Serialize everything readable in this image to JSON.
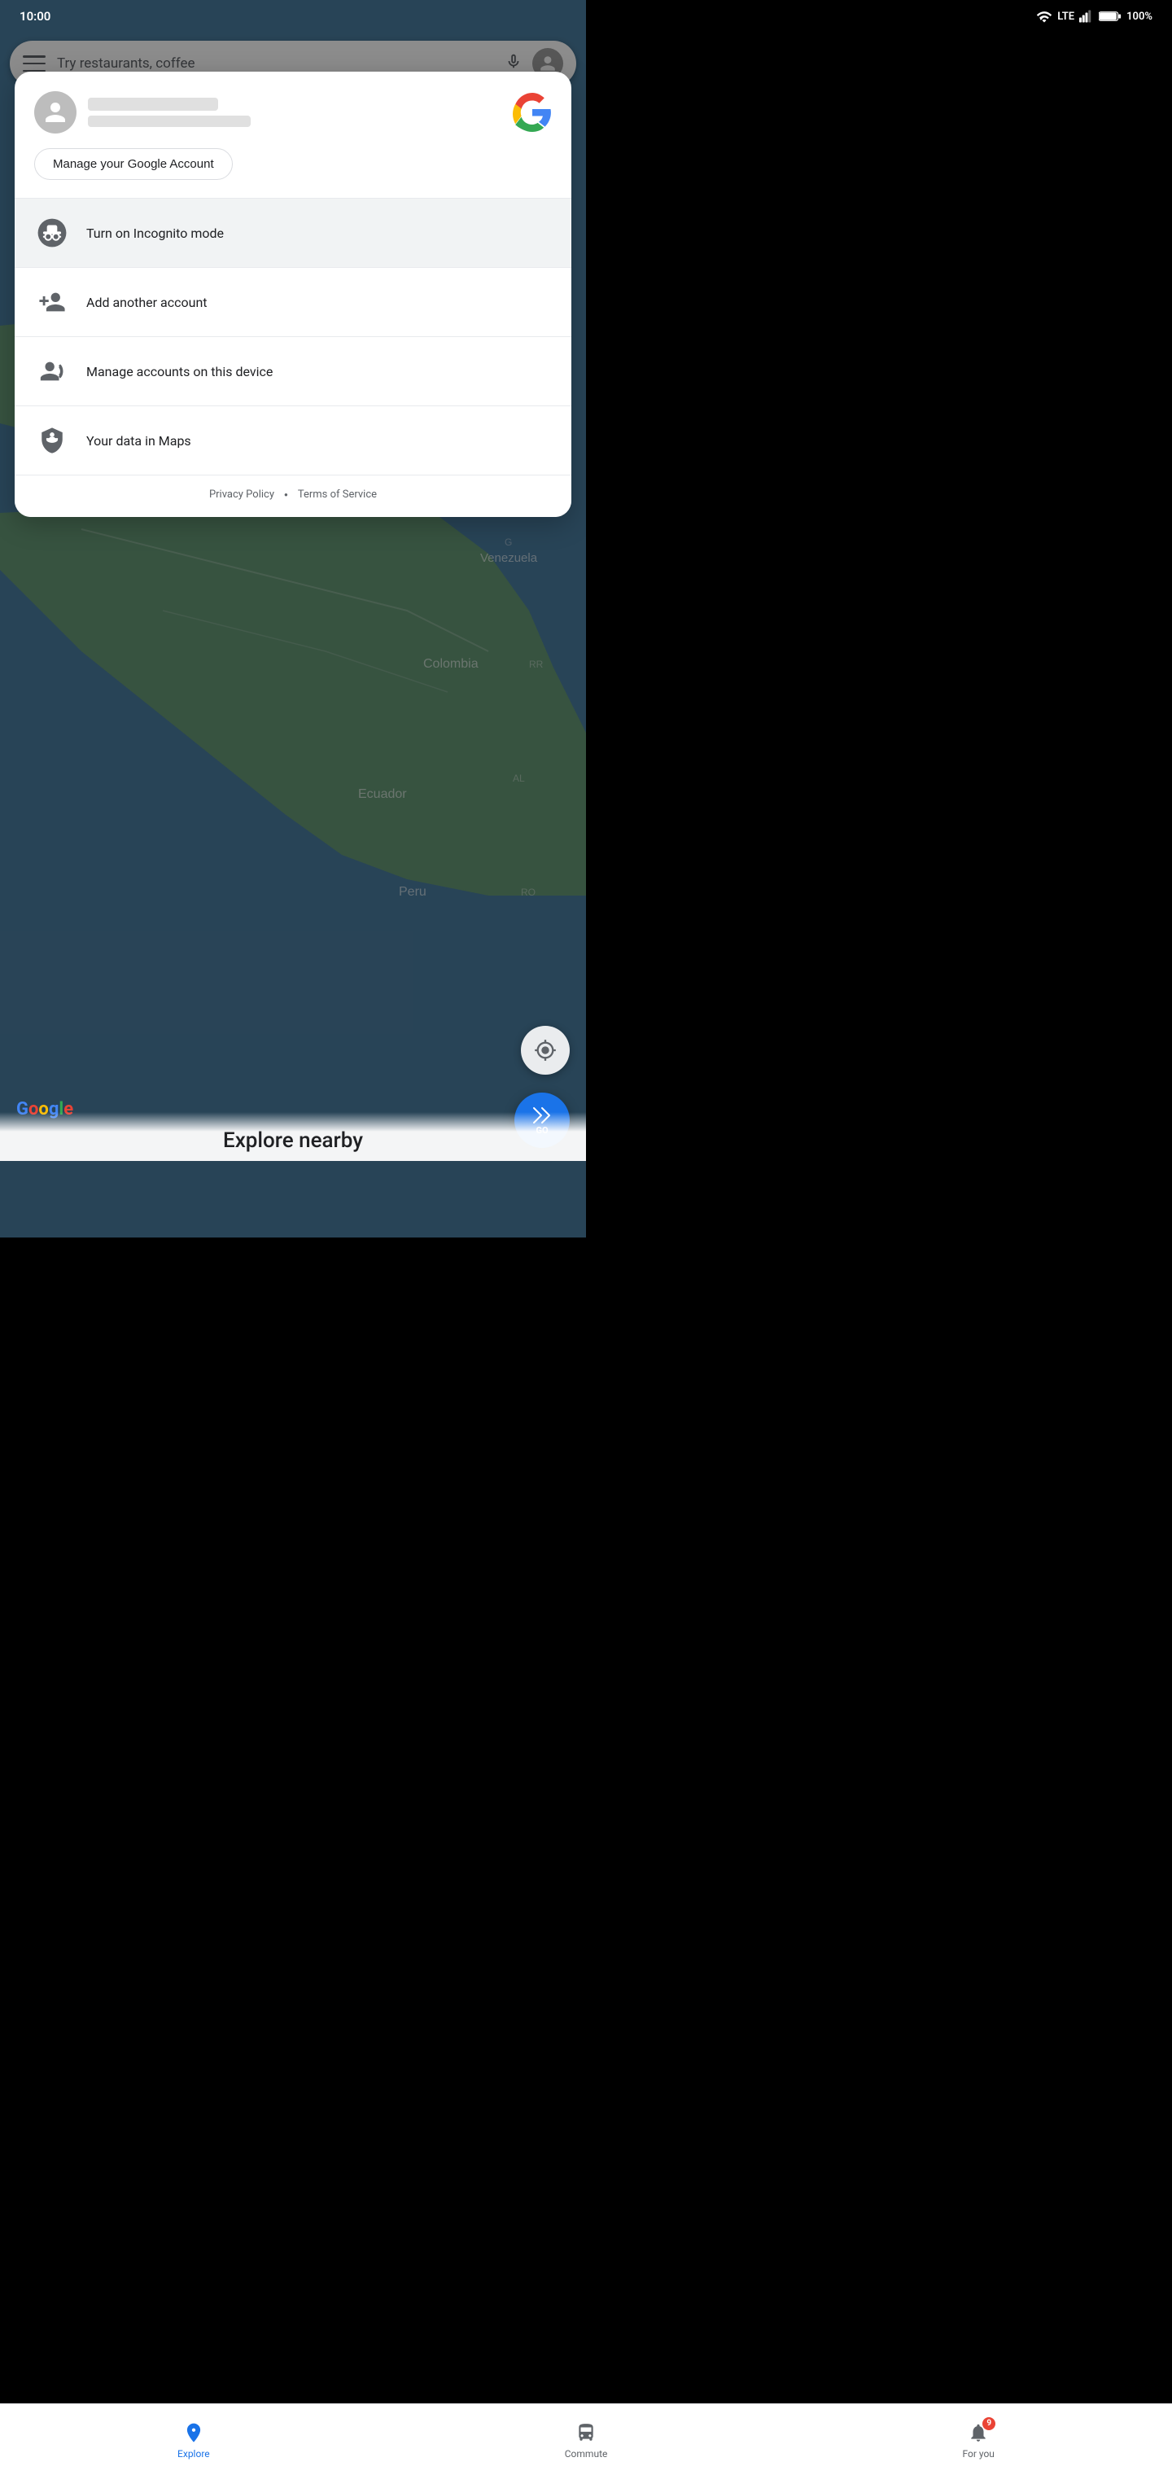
{
  "statusBar": {
    "time": "10:00",
    "signal": "LTE",
    "battery": "100%"
  },
  "searchBar": {
    "placeholder": "Try restaurants, coffee"
  },
  "modal": {
    "manageButton": "Manage your Google Account",
    "menuItems": [
      {
        "id": "incognito",
        "label": "Turn on Incognito mode",
        "highlighted": true
      },
      {
        "id": "add-account",
        "label": "Add another account",
        "highlighted": false
      },
      {
        "id": "manage-accounts",
        "label": "Manage accounts on this device",
        "highlighted": false
      },
      {
        "id": "data-maps",
        "label": "Your data in Maps",
        "highlighted": false
      }
    ],
    "privacyPolicy": "Privacy Policy",
    "termsOfService": "Terms of Service"
  },
  "map": {
    "exploreText": "Explore nearby"
  },
  "bottomNav": {
    "items": [
      {
        "id": "explore",
        "label": "Explore",
        "active": true,
        "badge": null
      },
      {
        "id": "commute",
        "label": "Commute",
        "active": false,
        "badge": null
      },
      {
        "id": "for-you",
        "label": "For you",
        "active": false,
        "badge": "9"
      }
    ]
  },
  "fab": {
    "goLabel": "GO"
  }
}
